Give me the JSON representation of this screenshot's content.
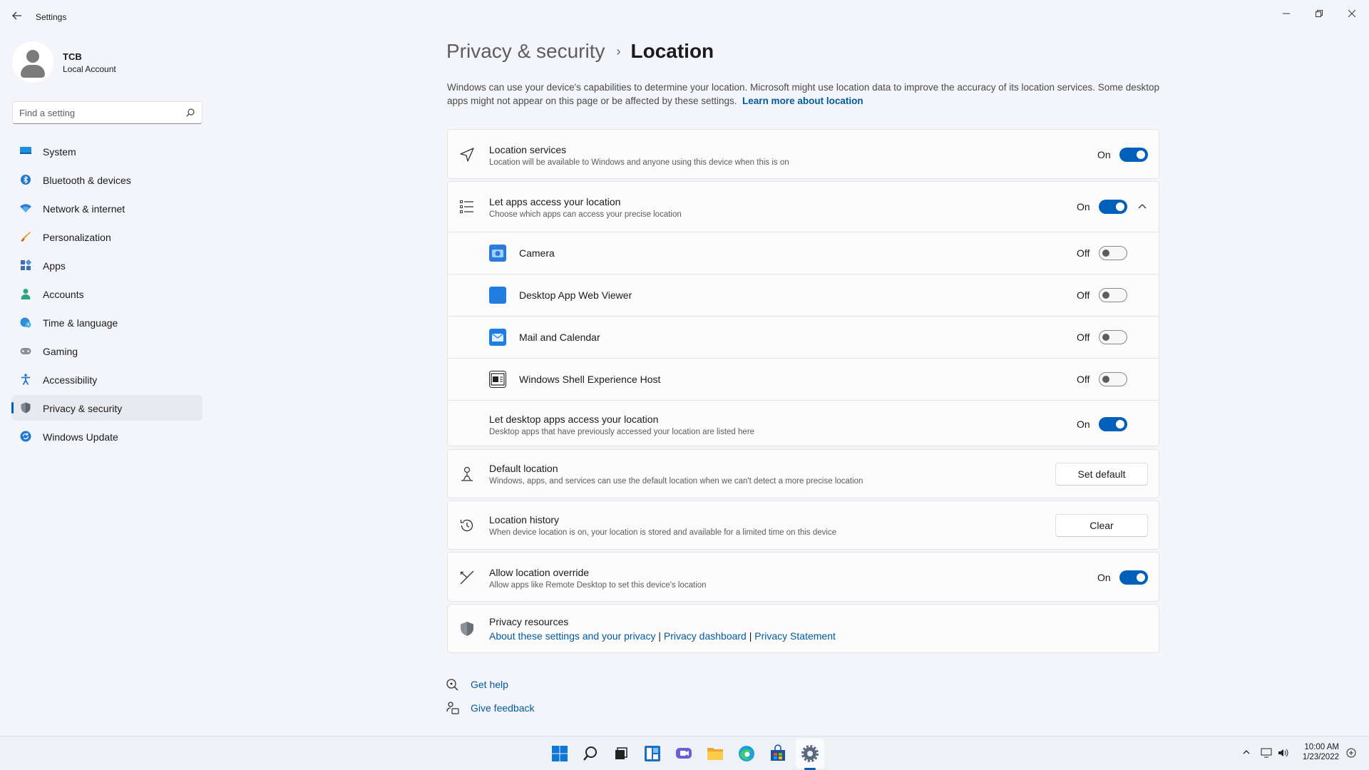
{
  "window": {
    "title": "Settings",
    "back_icon": "back-arrow-icon",
    "controls": {
      "minimize": "minimize-icon",
      "maximize": "restore-icon",
      "close": "close-icon"
    }
  },
  "profile": {
    "name": "TCB",
    "account_type": "Local Account"
  },
  "search": {
    "placeholder": "Find a setting",
    "value": ""
  },
  "sidebar": {
    "items": [
      {
        "label": "System",
        "icon": "system-icon"
      },
      {
        "label": "Bluetooth & devices",
        "icon": "bluetooth-icon"
      },
      {
        "label": "Network & internet",
        "icon": "wifi-icon"
      },
      {
        "label": "Personalization",
        "icon": "brush-icon"
      },
      {
        "label": "Apps",
        "icon": "apps-icon"
      },
      {
        "label": "Accounts",
        "icon": "person-icon"
      },
      {
        "label": "Time & language",
        "icon": "globe-clock-icon"
      },
      {
        "label": "Gaming",
        "icon": "controller-icon"
      },
      {
        "label": "Accessibility",
        "icon": "accessibility-icon"
      },
      {
        "label": "Privacy & security",
        "icon": "shield-icon",
        "active": true
      },
      {
        "label": "Windows Update",
        "icon": "update-icon"
      }
    ]
  },
  "breadcrumb": {
    "parent": "Privacy & security",
    "separator": "›",
    "current": "Location"
  },
  "description": {
    "text": "Windows can use your device's capabilities to determine your location. Microsoft might use location data to improve the accuracy of its location services. Some desktop apps might not appear on this page or be affected by these settings.",
    "link": "Learn more about location"
  },
  "location_services": {
    "title": "Location services",
    "subtitle": "Location will be available to Windows and anyone using this device when this is on",
    "state": "On"
  },
  "app_access": {
    "title": "Let apps access your location",
    "subtitle": "Choose which apps can access your precise location",
    "state": "On",
    "apps": [
      {
        "name": "Camera",
        "state": "Off",
        "icon": "camera-app-icon"
      },
      {
        "name": "Desktop App Web Viewer",
        "state": "Off",
        "icon": "web-viewer-app-icon"
      },
      {
        "name": "Mail and Calendar",
        "state": "Off",
        "icon": "mail-app-icon"
      },
      {
        "name": "Windows Shell Experience Host",
        "state": "Off",
        "icon": "shell-host-app-icon"
      }
    ],
    "desktop": {
      "title": "Let desktop apps access your location",
      "subtitle": "Desktop apps that have previously accessed your location are listed here",
      "state": "On"
    }
  },
  "default_location": {
    "title": "Default location",
    "subtitle": "Windows, apps, and services can use the default location when we can't detect a more precise location",
    "button": "Set default"
  },
  "location_history": {
    "title": "Location history",
    "subtitle": "When device location is on, your location is stored and available for a limited time on this device",
    "button": "Clear"
  },
  "override": {
    "title": "Allow location override",
    "subtitle": "Allow apps like Remote Desktop to set this device's location",
    "state": "On"
  },
  "privacy_resources": {
    "title": "Privacy resources",
    "links": [
      "About these settings and your privacy",
      "Privacy dashboard",
      "Privacy Statement"
    ],
    "separator": "|"
  },
  "help": {
    "get_help": "Get help",
    "give_feedback": "Give feedback"
  },
  "taskbar": {
    "icons": [
      "windows-start-icon",
      "search-icon",
      "task-view-icon",
      "widgets-icon",
      "chat-icon",
      "file-explorer-icon",
      "edge-icon",
      "store-icon",
      "settings-icon"
    ],
    "time": "10:00 AM",
    "date": "1/23/2022"
  },
  "colors": {
    "accent": "#005fb8",
    "link": "#005a9e",
    "background": "#f3f5fa"
  }
}
